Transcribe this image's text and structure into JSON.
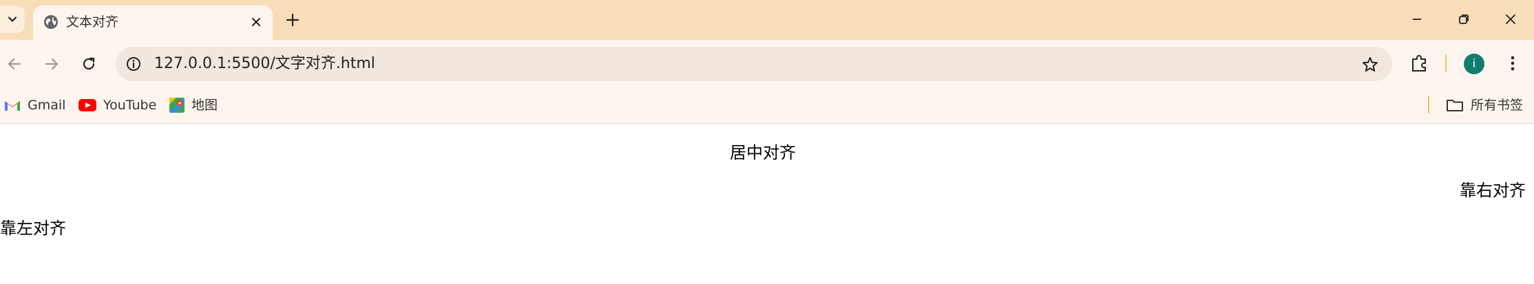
{
  "browser": {
    "tab": {
      "title": "文本对齐"
    },
    "address_bar": {
      "url": "127.0.0.1:5500/文字对齐.html"
    },
    "profile": {
      "initial": "i",
      "color": "#117d6f"
    },
    "accent_color": "#f7ddb8"
  },
  "bookmarks": {
    "items": [
      {
        "label": "Gmail",
        "icon": "gmail-icon"
      },
      {
        "label": "YouTube",
        "icon": "youtube-icon"
      },
      {
        "label": "地图",
        "icon": "maps-icon"
      }
    ],
    "all_bookmarks": {
      "label": "所有书签",
      "icon": "folder-icon"
    }
  },
  "page": {
    "center_text": "居中对齐",
    "right_text": "靠右对齐",
    "left_text": "靠左对齐"
  }
}
